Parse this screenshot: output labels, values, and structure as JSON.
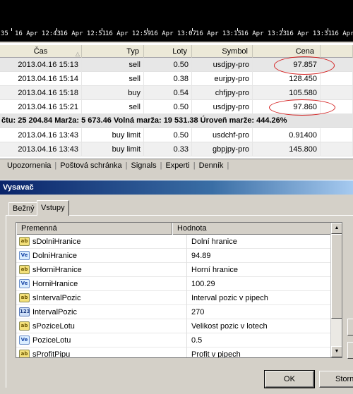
{
  "chart": {
    "time_ticks": [
      "35",
      "16 Apr 12:43",
      "16 Apr 12:51",
      "16 Apr 12:59",
      "16 Apr 13:07",
      "16 Apr 13:15",
      "16 Apr 13:23",
      "16 Apr 13:31",
      "16 Apr"
    ]
  },
  "terminal": {
    "columns": [
      "Čas",
      "Typ",
      "Loty",
      "Symbol",
      "Cena"
    ],
    "orders": [
      {
        "time": "2013.04.16 15:13",
        "type": "sell",
        "lots": "0.50",
        "symbol": "usdjpy-pro",
        "price": "97.857"
      },
      {
        "time": "2013.04.16 15:14",
        "type": "sell",
        "lots": "0.38",
        "symbol": "eurjpy-pro",
        "price": "128.450"
      },
      {
        "time": "2013.04.16 15:18",
        "type": "buy",
        "lots": "0.54",
        "symbol": "chfjpy-pro",
        "price": "105.580"
      },
      {
        "time": "2013.04.16 15:21",
        "type": "sell",
        "lots": "0.50",
        "symbol": "usdjpy-pro",
        "price": "97.860"
      }
    ],
    "summary": "čtu: 25 204.84  Marža: 5 673.46  Volná marža: 19 531.38  Úroveň marže: 444.26%",
    "pending": [
      {
        "time": "2013.04.16 13:43",
        "type": "buy limit",
        "lots": "0.50",
        "symbol": "usdchf-pro",
        "price": "0.91400"
      },
      {
        "time": "2013.04.16 13:43",
        "type": "buy limit",
        "lots": "0.33",
        "symbol": "gbpjpy-pro",
        "price": "145.800"
      }
    ],
    "tabs": [
      "Upozornenia",
      "Poštová schránka",
      "Signals",
      "Experti",
      "Denník"
    ],
    "highlight_color": "#d42020"
  },
  "dialog": {
    "title": "Vysavač",
    "tabs": [
      "Bežný",
      "Vstupy"
    ],
    "active_tab": "Vstupy",
    "grid_headers": [
      "Premenná",
      "Hodnota"
    ],
    "params": [
      {
        "icon": "ab",
        "name": "sDolniHranice",
        "value": "Dolní hranice"
      },
      {
        "icon": "Ve",
        "name": "DolniHranice",
        "value": "94.89"
      },
      {
        "icon": "ab",
        "name": "sHorniHranice",
        "value": "Horní hranice"
      },
      {
        "icon": "Ve",
        "name": "HorniHranice",
        "value": "100.29"
      },
      {
        "icon": "ab",
        "name": "sIntervalPozic",
        "value": "Interval pozic v pipech"
      },
      {
        "icon": "123",
        "name": "IntervalPozic",
        "value": "270"
      },
      {
        "icon": "ab",
        "name": "sPoziceLotu",
        "value": "Velikost pozic v lotech"
      },
      {
        "icon": "Ve",
        "name": "PoziceLotu",
        "value": "0.5"
      },
      {
        "icon": "ab",
        "name": "sProfitPipu",
        "value": "Profit v pipech"
      }
    ],
    "ok_label": "OK",
    "cancel_label": "Storn",
    "title_color": "#0a246a"
  }
}
